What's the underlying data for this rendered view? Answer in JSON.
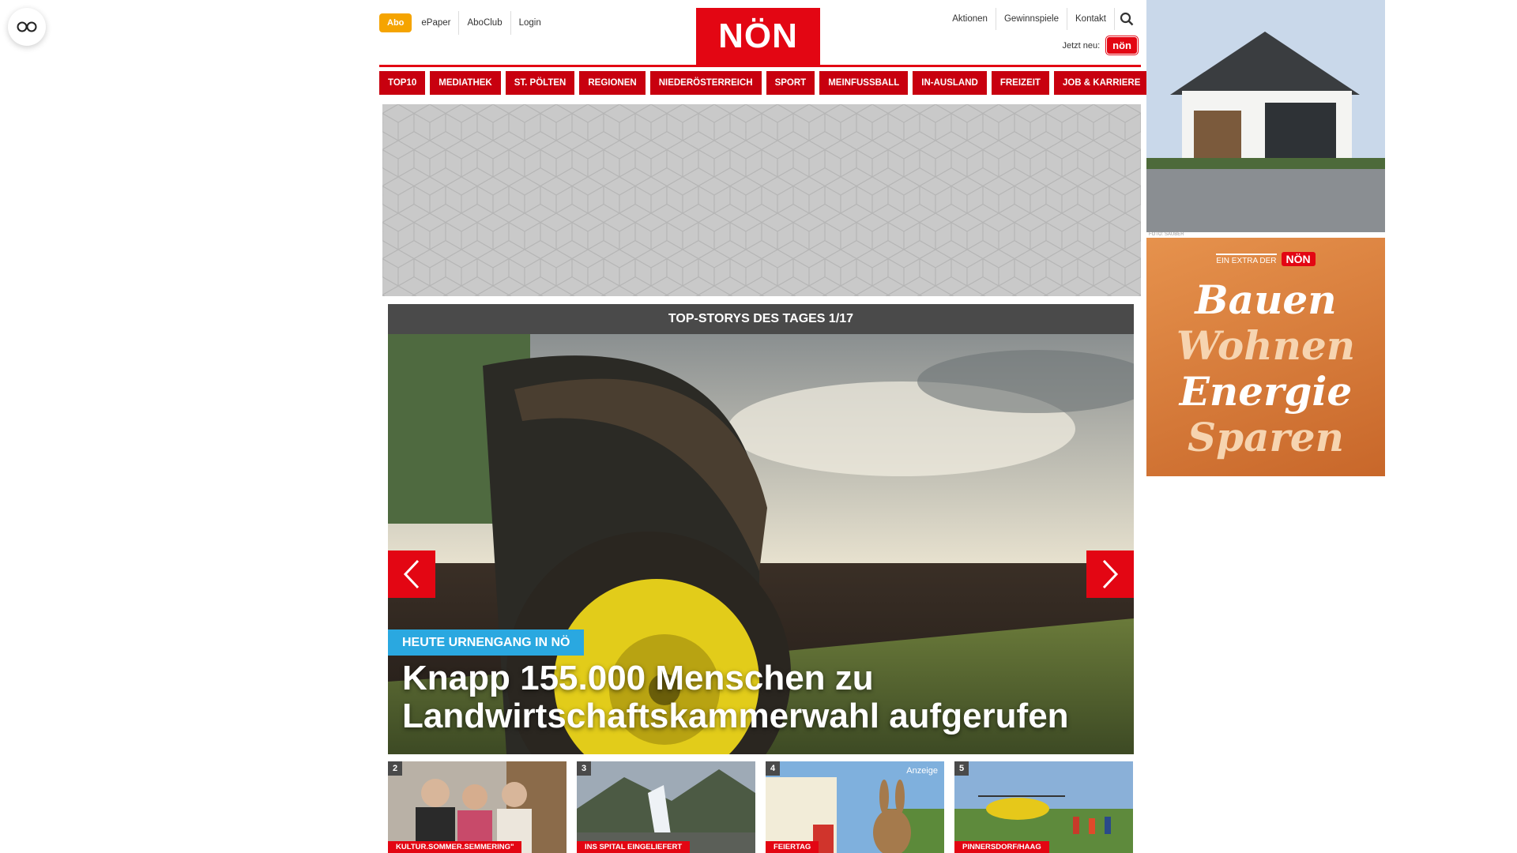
{
  "topbar": {
    "abo": "Abo",
    "links": [
      "ePaper",
      "AboClub",
      "Login"
    ],
    "logo": "NÖN",
    "right_links": [
      "Aktionen",
      "Gewinnspiele",
      "Kontakt"
    ],
    "jetzt_label": "Jetzt neu:",
    "jetzt_badge": "nön"
  },
  "nav": [
    "TOP10",
    "MEDIATHEK",
    "ST. PÖLTEN",
    "REGIONEN",
    "NIEDERÖSTERREICH",
    "SPORT",
    "MEINFUSSBALL",
    "IN-AUSLAND",
    "FREIZEIT",
    "JOB & KARRIERE"
  ],
  "stories": {
    "header": "TOP-STORYS DES TAGES 1/17",
    "kicker": "HEUTE URNENGANG IN NÖ",
    "headline": "Knapp 155.000 Menschen zu Landwirtschaftskammerwahl aufgerufen"
  },
  "teasers": [
    {
      "num": "2",
      "category": "KULTUR.SOMMER.SEMMERING\"",
      "anzeige": ""
    },
    {
      "num": "3",
      "category": "INS SPITAL EINGELIEFERT",
      "anzeige": ""
    },
    {
      "num": "4",
      "category": "FEIERTAG",
      "anzeige": "Anzeige"
    },
    {
      "num": "5",
      "category": "PINNERSDORF/HAAG",
      "anzeige": ""
    }
  ],
  "ads": {
    "top_credit": "FOTO: SAUBER",
    "bottom_extra": "EIN EXTRA DER",
    "bottom_logo": "NÖN",
    "bottom_words": [
      "Bauen",
      "Wohnen",
      "Energie",
      "Sparen"
    ]
  },
  "colors": {
    "brand_red": "#e30613",
    "abo_orange": "#f5a400",
    "kicker_blue": "#2aa8e0",
    "dark_bar": "#4a4a4a"
  }
}
